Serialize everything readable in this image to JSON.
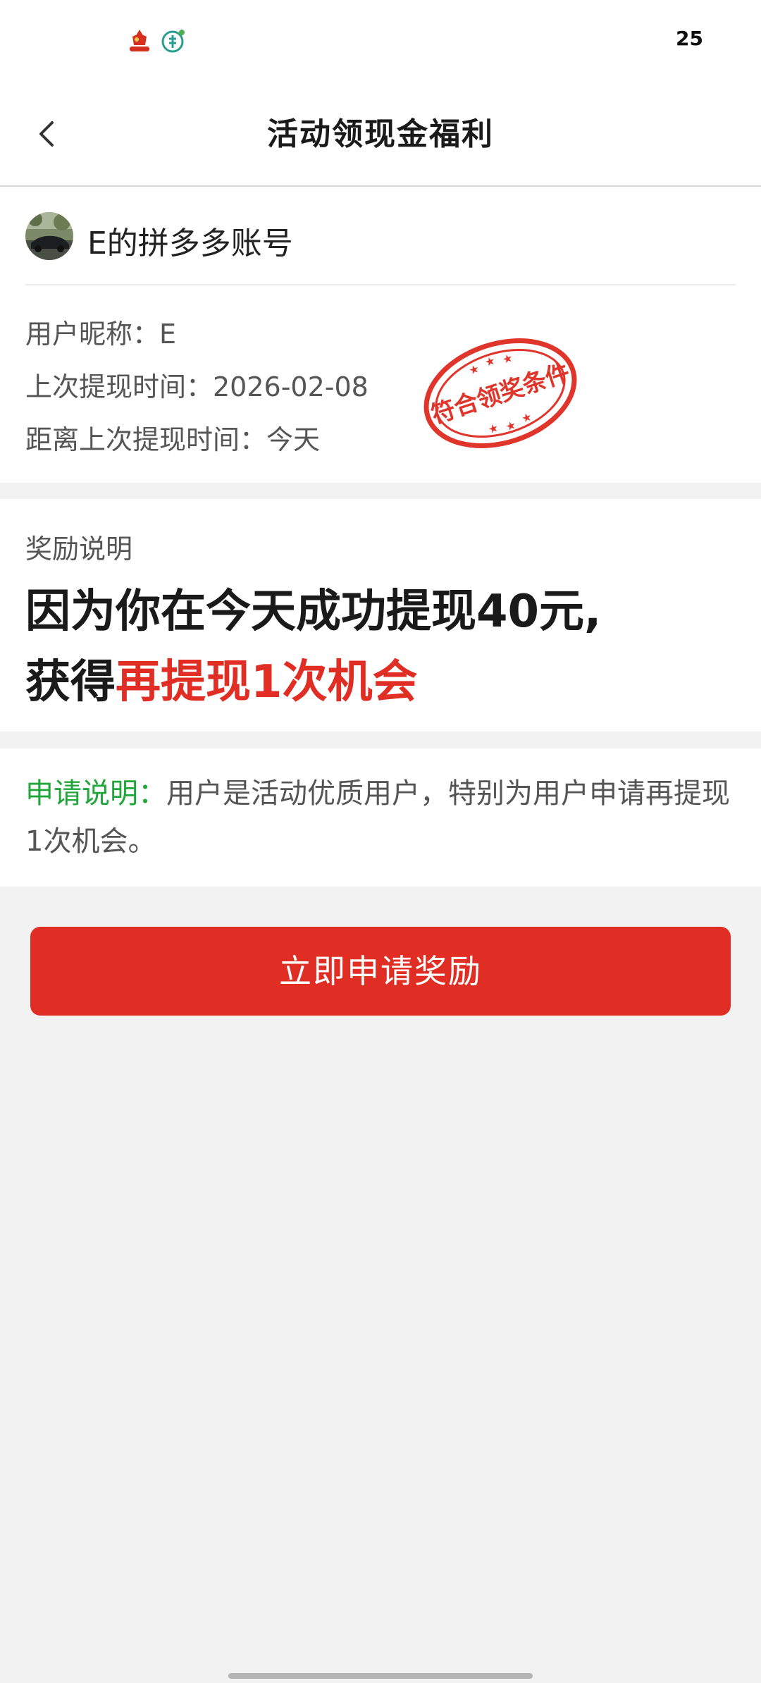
{
  "status_bar": {
    "time": "25",
    "icons": [
      "app-notification-icon",
      "leaf-icon"
    ]
  },
  "header": {
    "title": "活动领现金福利",
    "back_icon": "chevron-left-icon"
  },
  "account": {
    "name": "E的拼多多账号",
    "nickname_line": "用户昵称：E",
    "last_withdraw_line": "上次提现时间：2026-02-08",
    "since_last_line": "距离上次提现时间：今天",
    "stamp_text": "符合领奖条件"
  },
  "reward": {
    "label": "奖励说明",
    "line1": "因为你在今天成功提现40元,",
    "line2_prefix": "获得",
    "line2_highlight": "再提现1次机会"
  },
  "apply": {
    "label": "申请说明：",
    "text": "用户是活动优质用户，特别为用户申请再提现1次机会。"
  },
  "cta": {
    "label": "立即申请奖励"
  },
  "colors": {
    "accent_red": "#e02e24",
    "label_green": "#21a63a",
    "background": "#f2f2f2"
  }
}
